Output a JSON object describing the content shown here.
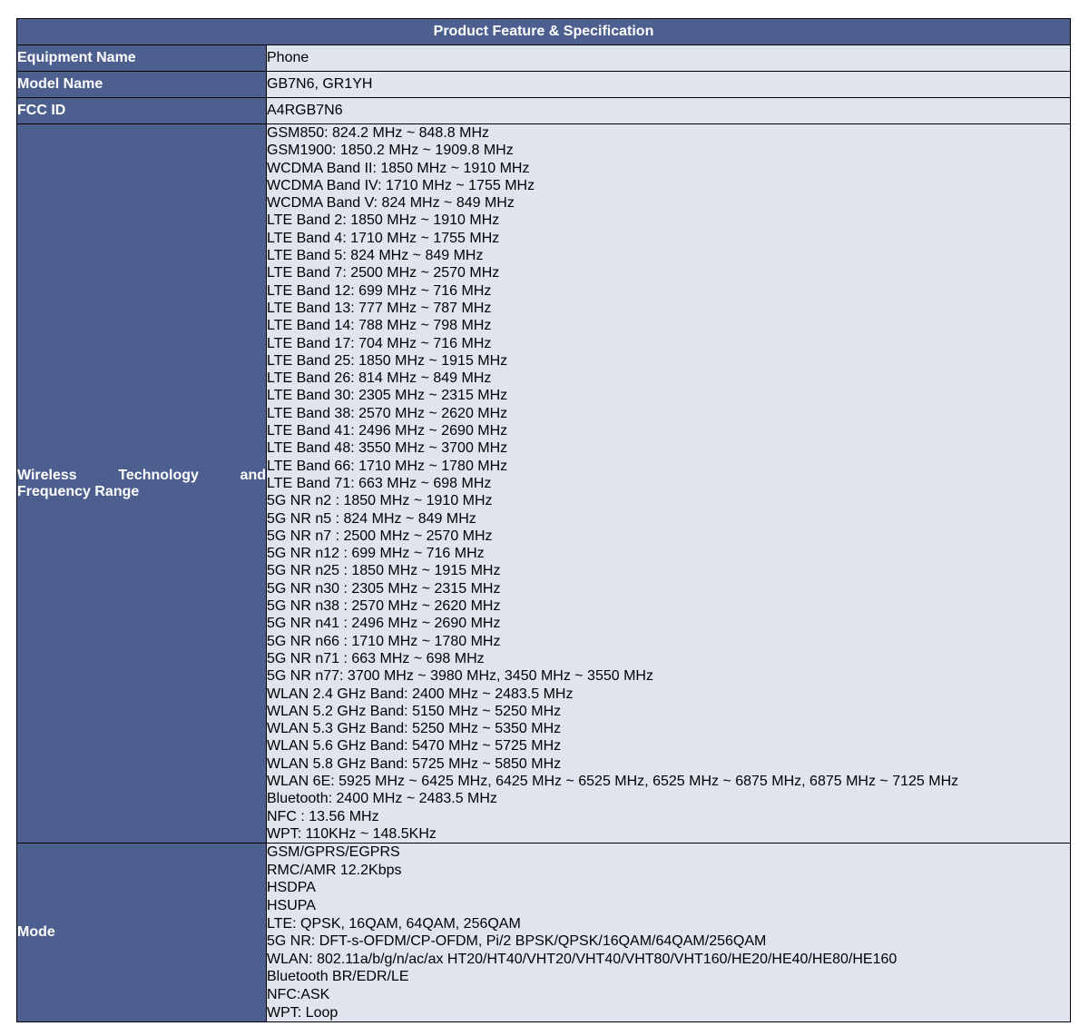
{
  "title": "Product Feature & Specification",
  "rows": {
    "equipment_name": {
      "label": "Equipment Name",
      "value": "Phone"
    },
    "model_name": {
      "label": "Model Name",
      "value": "GB7N6, GR1YH"
    },
    "fcc_id": {
      "label": "FCC ID",
      "value": "A4RGB7N6"
    },
    "wireless": {
      "label": "Wireless Technology and Frequency Range",
      "lines": [
        "GSM850: 824.2 MHz ~ 848.8 MHz",
        "GSM1900: 1850.2 MHz ~ 1909.8 MHz",
        "WCDMA Band II: 1850 MHz ~ 1910 MHz",
        "WCDMA Band IV: 1710 MHz ~ 1755 MHz",
        "WCDMA Band V: 824 MHz ~ 849 MHz",
        "LTE Band 2: 1850 MHz ~ 1910 MHz",
        "LTE Band 4: 1710 MHz ~ 1755 MHz",
        "LTE Band 5: 824 MHz ~ 849 MHz",
        "LTE Band 7: 2500 MHz ~ 2570 MHz",
        "LTE Band 12: 699 MHz ~ 716 MHz",
        "LTE Band 13: 777 MHz ~ 787 MHz",
        "LTE Band 14: 788 MHz ~ 798 MHz",
        "LTE Band 17: 704 MHz ~ 716 MHz",
        "LTE Band 25: 1850 MHz ~ 1915 MHz",
        "LTE Band 26: 814 MHz ~ 849 MHz",
        "LTE Band 30: 2305 MHz ~ 2315 MHz",
        "LTE Band 38: 2570 MHz ~ 2620 MHz",
        "LTE Band 41: 2496 MHz ~ 2690 MHz",
        "LTE Band 48: 3550 MHz ~ 3700 MHz",
        "LTE Band 66: 1710 MHz ~ 1780 MHz",
        "LTE Band 71: 663 MHz ~ 698 MHz",
        "5G NR n2 : 1850 MHz ~ 1910 MHz",
        "5G NR n5 : 824 MHz ~ 849 MHz",
        "5G NR n7 : 2500 MHz ~ 2570 MHz",
        "5G NR n12 : 699 MHz ~ 716 MHz",
        "5G NR n25 : 1850 MHz ~ 1915 MHz",
        "5G NR n30 : 2305 MHz ~ 2315 MHz",
        "5G NR n38 : 2570 MHz ~ 2620 MHz",
        "5G NR n41 : 2496 MHz ~ 2690 MHz",
        "5G NR n66 : 1710 MHz ~ 1780 MHz",
        "5G NR n71 : 663 MHz ~ 698 MHz",
        "5G NR n77: 3700 MHz ~ 3980 MHz, 3450 MHz ~ 3550 MHz",
        "WLAN 2.4 GHz Band: 2400 MHz ~ 2483.5 MHz",
        "WLAN 5.2 GHz Band: 5150 MHz ~ 5250 MHz",
        "WLAN 5.3 GHz Band: 5250 MHz ~ 5350 MHz",
        "WLAN 5.6 GHz Band: 5470 MHz ~ 5725 MHz",
        "WLAN 5.8 GHz Band: 5725 MHz ~ 5850 MHz",
        "WLAN 6E: 5925 MHz ~ 6425 MHz, 6425 MHz ~ 6525 MHz, 6525 MHz ~ 6875 MHz, 6875 MHz ~ 7125 MHz",
        "Bluetooth: 2400 MHz ~ 2483.5 MHz",
        "NFC : 13.56 MHz",
        "WPT: 110KHz ~ 148.5KHz"
      ]
    },
    "mode": {
      "label": "Mode",
      "lines": [
        "GSM/GPRS/EGPRS",
        "RMC/AMR 12.2Kbps",
        "HSDPA",
        "HSUPA",
        "LTE: QPSK, 16QAM, 64QAM, 256QAM",
        "5G NR: DFT-s-OFDM/CP-OFDM, Pi/2 BPSK/QPSK/16QAM/64QAM/256QAM",
        "WLAN: 802.11a/b/g/n/ac/ax HT20/HT40/VHT20/VHT40/VHT80/VHT160/HE20/HE40/HE80/HE160",
        "Bluetooth BR/EDR/LE",
        "NFC:ASK",
        "WPT: Loop"
      ]
    }
  },
  "colors": {
    "header_bg": "#4d5f8f",
    "value_bg": "#dfe4ef",
    "border": "#000000"
  }
}
